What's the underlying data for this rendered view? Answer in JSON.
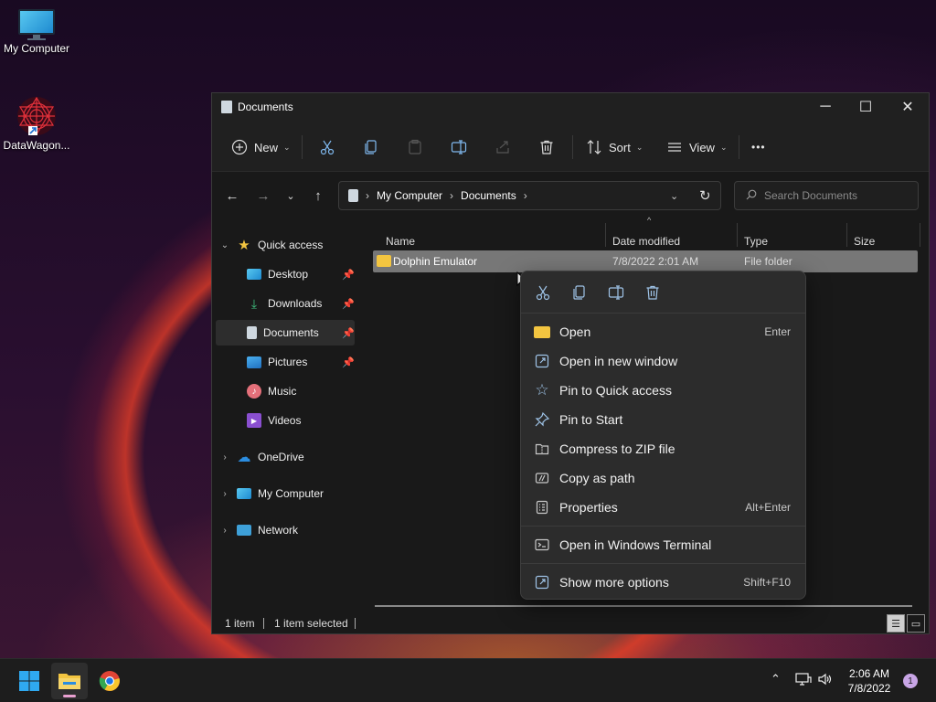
{
  "colors": {
    "accent": "#4cc2ff",
    "folder": "#f3c540",
    "selected_row": "#777777",
    "menu_bg": "#2c2c2c"
  },
  "desktop": {
    "icons": [
      {
        "label": "My Computer",
        "icon": "monitor-icon"
      },
      {
        "label": "DataWagon...",
        "icon": "datawagon-app-icon"
      }
    ]
  },
  "window": {
    "title": "Documents",
    "controls": {
      "minimize": "─",
      "maximize": "☐",
      "close": "✕"
    }
  },
  "toolbar": {
    "new_label": "New",
    "sort_label": "Sort",
    "view_label": "View",
    "more_label": "•••"
  },
  "navigation": {
    "breadcrumb": [
      "My Computer",
      "Documents"
    ],
    "search_placeholder": "Search Documents"
  },
  "sidebar": {
    "quick_access": "Quick access",
    "pinned": [
      {
        "label": "Desktop",
        "icon": "desktop-icon",
        "pinned": true
      },
      {
        "label": "Downloads",
        "icon": "download-icon",
        "pinned": true
      },
      {
        "label": "Documents",
        "icon": "documents-icon",
        "pinned": true,
        "selected": true
      },
      {
        "label": "Pictures",
        "icon": "pictures-icon",
        "pinned": true
      },
      {
        "label": "Music",
        "icon": "music-icon",
        "pinned": false
      },
      {
        "label": "Videos",
        "icon": "videos-icon",
        "pinned": false
      }
    ],
    "roots": [
      {
        "label": "OneDrive",
        "icon": "cloud-icon"
      },
      {
        "label": "My Computer",
        "icon": "monitor-icon"
      },
      {
        "label": "Network",
        "icon": "network-icon"
      }
    ]
  },
  "file_list": {
    "columns": [
      "Name",
      "Date modified",
      "Type",
      "Size"
    ],
    "rows": [
      {
        "name": "Dolphin Emulator",
        "date": "7/8/2022 2:01 AM",
        "type": "File folder",
        "size": ""
      }
    ]
  },
  "statusbar": {
    "count": "1 item",
    "selection": "1 item selected"
  },
  "context_menu": {
    "quick_actions": [
      "cut-icon",
      "copy-icon",
      "rename-icon",
      "delete-icon"
    ],
    "items": [
      {
        "label": "Open",
        "shortcut": "Enter",
        "icon": "folder-open-icon"
      },
      {
        "label": "Open in new window",
        "shortcut": "",
        "icon": "new-window-icon"
      },
      {
        "label": "Pin to Quick access",
        "shortcut": "",
        "icon": "star-icon"
      },
      {
        "label": "Pin to Start",
        "shortcut": "",
        "icon": "pin-icon"
      },
      {
        "label": "Compress to ZIP file",
        "shortcut": "",
        "icon": "zip-icon"
      },
      {
        "label": "Copy as path",
        "shortcut": "",
        "icon": "path-icon"
      },
      {
        "label": "Properties",
        "shortcut": "Alt+Enter",
        "icon": "properties-icon"
      }
    ],
    "terminal": {
      "label": "Open in Windows Terminal",
      "icon": "terminal-icon"
    },
    "more": {
      "label": "Show more options",
      "shortcut": "Shift+F10",
      "icon": "more-options-icon"
    }
  },
  "taskbar": {
    "clock_time": "2:06 AM",
    "clock_date": "7/8/2022",
    "notification_count": "1"
  }
}
